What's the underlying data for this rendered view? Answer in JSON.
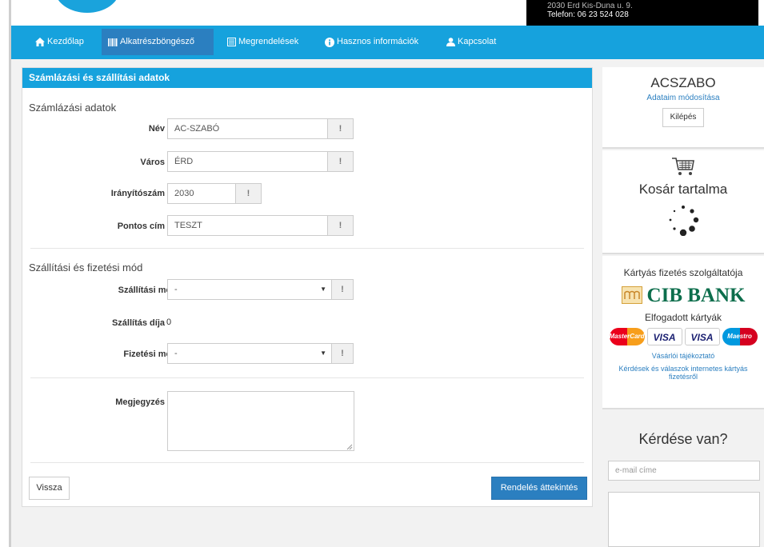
{
  "header": {
    "address_line": "2030 Érd Kis-Duna u. 9.",
    "phone": "Telefon: 06 23 524 028"
  },
  "nav": {
    "items": [
      {
        "label": "Kezdőlap",
        "icon": "home-icon"
      },
      {
        "label": "Alkatrészböngésző",
        "icon": "barcode-icon"
      },
      {
        "label": "Megrendelések",
        "icon": "list-icon"
      },
      {
        "label": "Hasznos információk",
        "icon": "info-icon"
      },
      {
        "label": "Kapcsolat",
        "icon": "user-icon"
      }
    ],
    "active": "Alkatrészböngésző"
  },
  "form": {
    "title": "Számlázási és szállítási adatok",
    "billing_section": "Számlázási adatok",
    "name_label": "Név",
    "name_value": "AC-SZABÓ",
    "city_label": "Város",
    "city_value": "ÉRD",
    "zip_label": "Irányítószám",
    "zip_value": "2030",
    "address_label": "Pontos cím",
    "address_value": "TESZT",
    "addon_symbol": "!",
    "shipping_section": "Szállítási és fizetési mód",
    "shipping_method_label": "Szállítási mód",
    "shipping_method_value": "-",
    "shipping_fee_label": "Szállítás díja",
    "shipping_fee_value": "0",
    "payment_method_label": "Fizetési mód",
    "payment_method_value": "-",
    "note_label": "Megjegyzés",
    "note_value": "",
    "back_button": "Vissza",
    "review_button": "Rendelés áttekintés"
  },
  "sidebar": {
    "user_name": "ACSZABO",
    "edit_link": "Adataim módosítása",
    "logout_button": "Kilépés",
    "cart_title": "Kosár tartalma",
    "payment_provider_title": "Kártyás fizetés szolgáltatója",
    "bank_name": "CIB BANK",
    "accepted_cards_title": "Elfogadott kártyák",
    "cards": [
      "MasterCard",
      "VISA",
      "VISA",
      "Maestro"
    ],
    "purchase_info_link": "Vásárlói tájékoztató",
    "faq_link": "Kérdések és válaszok internetes kártyás fizetésről",
    "question_title": "Kérdése van?",
    "email_placeholder": "e-mail címe"
  },
  "colors": {
    "accent": "#16a2dd",
    "active_nav": "#2b7fc0",
    "primary_button": "#2b7fc0"
  }
}
